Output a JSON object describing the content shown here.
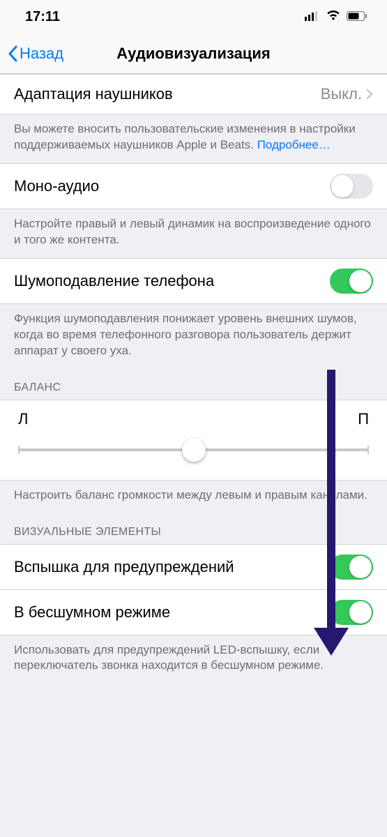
{
  "status": {
    "time": "17:11"
  },
  "nav": {
    "back": "Назад",
    "title": "Аудиовизуализация"
  },
  "row_headphones": {
    "label": "Адаптация наушников",
    "value": "Выкл."
  },
  "footer1": {
    "text": "Вы можете вносить пользовательские изменения в настройки поддерживаемых наушников Apple и Beats.",
    "link": "Подробнее…"
  },
  "row_mono": {
    "label": "Моно-аудио"
  },
  "footer2": "Настройте правый и левый динамик на воспроизведение одного и того же контента.",
  "row_noise": {
    "label": "Шумоподавление телефона"
  },
  "footer3": "Функция шумоподавления понижает уровень внешних шумов, когда во время телефонного разговора пользователь держит аппарат у своего уха.",
  "section_balance": "БАЛАНС",
  "balance": {
    "left": "Л",
    "right": "П"
  },
  "footer4": "Настроить баланс громкости между левым и правым каналами.",
  "section_visual": "ВИЗУАЛЬНЫЕ ЭЛЕМЕНТЫ",
  "row_flash": {
    "label": "Вспышка для предупреждений"
  },
  "row_silent": {
    "label": "В бесшумном режиме"
  },
  "footer5": "Использовать для предупреждений LED-вспышку, если переключатель звонка находится в бесшумном режиме."
}
